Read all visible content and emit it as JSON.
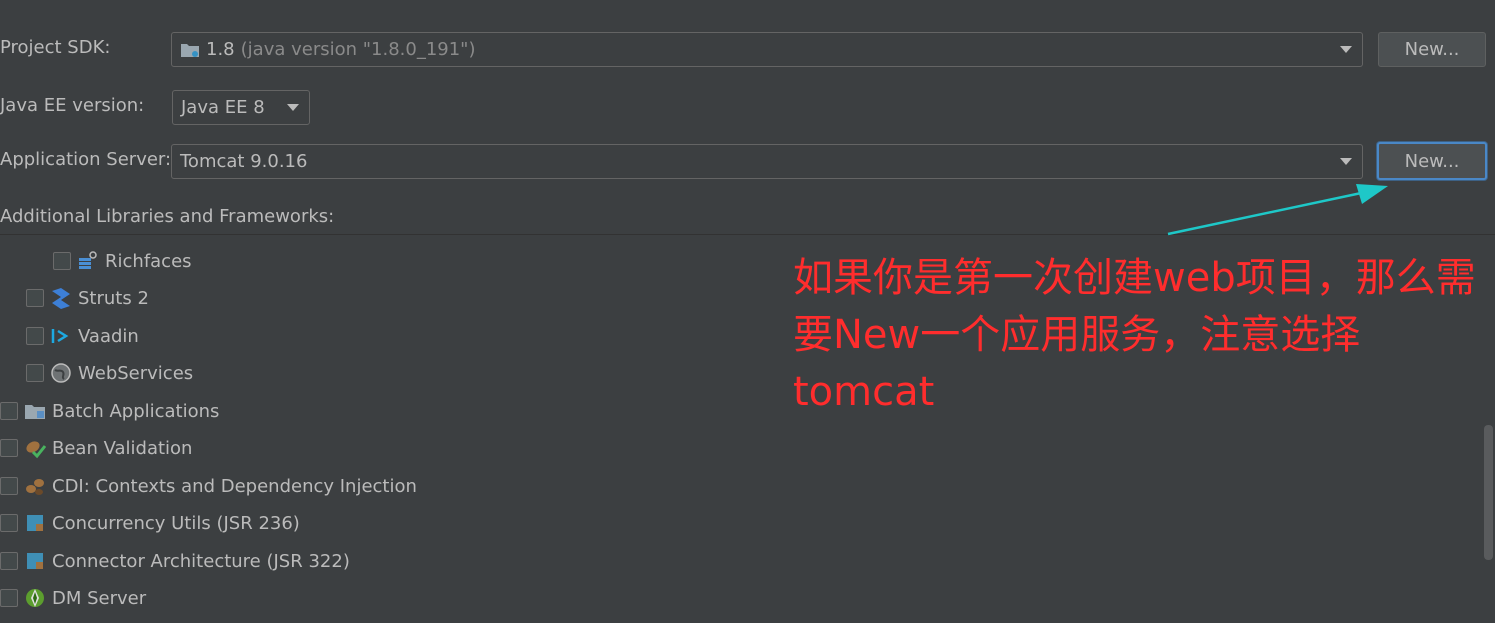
{
  "form": {
    "sdk_label": "Project SDK:",
    "sdk_value_main": "1.8",
    "sdk_value_detail": "(java version \"1.8.0_191\")",
    "sdk_new": "New...",
    "javaee_label": "Java EE version:",
    "javaee_value": "Java EE 8",
    "server_label": "Application Server:",
    "server_value": "Tomcat 9.0.16",
    "server_new": "New...",
    "libs_label": "Additional Libraries and Frameworks:"
  },
  "frameworks": [
    {
      "label": "Richfaces",
      "icon": "richfaces-icon"
    },
    {
      "label": "Struts 2",
      "icon": "struts-icon"
    },
    {
      "label": "Vaadin",
      "icon": "vaadin-icon"
    },
    {
      "label": "WebServices",
      "icon": "webservices-icon"
    },
    {
      "label": "Batch Applications",
      "icon": "batch-icon"
    },
    {
      "label": "Bean Validation",
      "icon": "bean-validation-icon"
    },
    {
      "label": "CDI: Contexts and Dependency Injection",
      "icon": "cdi-icon"
    },
    {
      "label": "Concurrency Utils (JSR 236)",
      "icon": "concurrency-icon"
    },
    {
      "label": "Connector Architecture (JSR 322)",
      "icon": "connector-icon"
    },
    {
      "label": "DM Server",
      "icon": "dm-server-icon"
    }
  ],
  "annotation": {
    "text": "如果你是第一次创建web项目，那么需要New一个应用服务，注意选择tomcat",
    "color": "#ff2d2d",
    "arrow_color": "#1ec8c8"
  }
}
